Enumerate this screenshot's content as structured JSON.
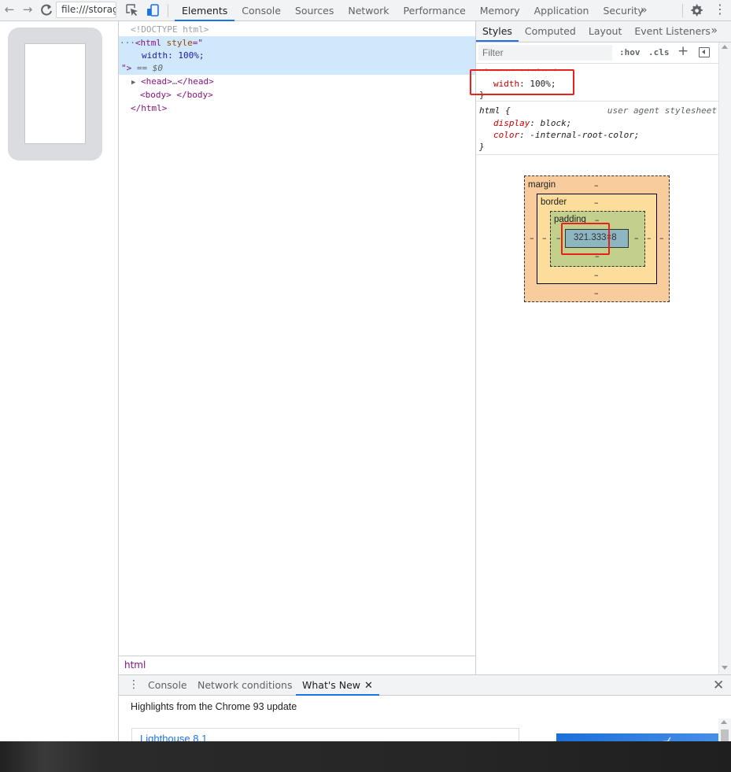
{
  "browser": {
    "url_text": "file:///storag"
  },
  "devtools": {
    "tabs": [
      {
        "label": "Elements",
        "active": true
      },
      {
        "label": "Console"
      },
      {
        "label": "Sources"
      },
      {
        "label": "Network"
      },
      {
        "label": "Performance"
      },
      {
        "label": "Memory"
      },
      {
        "label": "Application"
      },
      {
        "label": "Security"
      }
    ],
    "more_tabs_glyph": "»"
  },
  "elements_panel": {
    "doctype": "<!DOCTYPE html>",
    "selected": {
      "ellipsis": "···",
      "open_tag": "<html",
      "attr_name": " style",
      "attr_eq": "=\"",
      "attr_value": "width: 100%;",
      "close_quote": "\">",
      "eq_marker": " == $0"
    },
    "head": {
      "open": "<head>",
      "ellipsis": "…",
      "close": "</head>"
    },
    "body": {
      "open": "<body>",
      "close": " </body>"
    },
    "html_close": "</html>",
    "breadcrumb": "html"
  },
  "styles_panel": {
    "subtabs": [
      {
        "label": "Styles",
        "active": true
      },
      {
        "label": "Computed"
      },
      {
        "label": "Layout"
      },
      {
        "label": "Event Listeners"
      }
    ],
    "more_glyph": "»",
    "filter_placeholder": "Filter",
    "hov_label": ":hov",
    "cls_label": ".cls",
    "plus_label": "+",
    "element_style": {
      "selector": "element.style {",
      "prop": "width",
      "value": "100%;",
      "close": "}"
    },
    "html_rule": {
      "selector": "html {",
      "source": "user agent stylesheet",
      "props": [
        {
          "name": "display",
          "value": "block;"
        },
        {
          "name": "color",
          "value": "-internal-root-color;"
        }
      ],
      "close": "}"
    }
  },
  "box_model": {
    "margin_label": "margin",
    "border_label": "border",
    "padding_label": "padding",
    "dash": "–",
    "content_size": "321.333×8",
    "colors": {
      "margin": "#f9cc9d",
      "border": "#fddd9b",
      "padding": "#c3d08b",
      "content": "#8cb6c0"
    }
  },
  "drawer": {
    "tabs": [
      {
        "label": "Console"
      },
      {
        "label": "Network conditions"
      },
      {
        "label": "What's New",
        "active": true,
        "close": "✕"
      }
    ],
    "close_glyph": "✕",
    "headline": "Highlights from the Chrome 93 update",
    "card_link": "Lighthouse 8.1"
  },
  "colors": {
    "accent": "#1a73e8",
    "highlight_box": "#e8211a"
  }
}
